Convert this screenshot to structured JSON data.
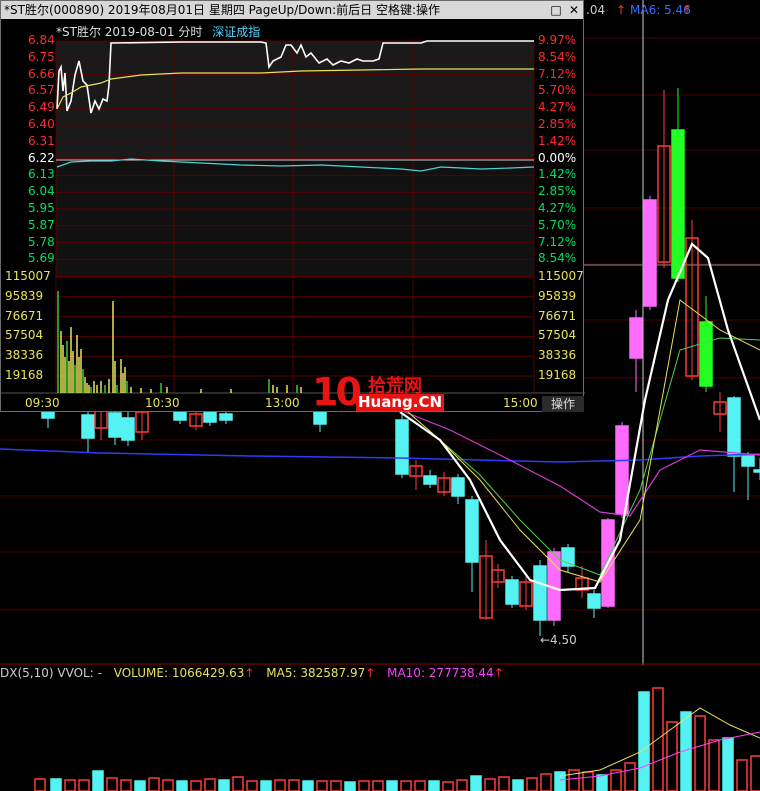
{
  "popup": {
    "title": "*ST胜尔(000890) 2019年08月01日 星期四 PageUp/Down:前后日 空格键:操作",
    "stock": "*ST胜尔",
    "date": "2019-08-01",
    "mode": "分时",
    "index_name": "深证成指",
    "minimize_icon": "□",
    "close_icon": "✕",
    "action_label": "操作",
    "price_labels": [
      "6.84",
      "6.75",
      "6.66",
      "6.57",
      "6.49",
      "6.40",
      "6.31",
      "6.22",
      "6.13",
      "6.04",
      "5.95",
      "5.87",
      "5.78",
      "5.69"
    ],
    "pct_labels": [
      "9.97%",
      "8.54%",
      "7.12%",
      "5.70%",
      "4.27%",
      "2.85%",
      "1.42%",
      "0.00%",
      "1.42%",
      "2.85%",
      "4.27%",
      "5.70%",
      "7.12%",
      "8.54%"
    ],
    "volume_labels": [
      "115007",
      "95839",
      "76671",
      "57504",
      "38336",
      "19168"
    ],
    "time_labels": [
      "09:30",
      "10:30",
      "13:00",
      "15:00"
    ],
    "colors": {
      "up": "#ff2a2a",
      "down": "#00e060",
      "neutral": "#ffffff",
      "price_line": "#ffffff",
      "avg_line": "#e8e25a",
      "index_line": "#4fd3d3",
      "volume": "#e8e25a",
      "vol_green": "#33cc33"
    }
  },
  "header": {
    "ma_prefix": ".04",
    "ma6_label": "MA6: 5.46"
  },
  "kline": {
    "low_label": "←4.50"
  },
  "volume_panel": {
    "indicator": "DX(5,10)",
    "vvol": "VVOL: -",
    "volume": "VOLUME: 1066429.63",
    "ma5": "MA5: 382587.97",
    "ma10": "MA10: 277738.44",
    "arrow": "↑"
  },
  "watermark": {
    "digits": "10",
    "cn": "拾荒网",
    "en": "Huang.CN"
  }
}
